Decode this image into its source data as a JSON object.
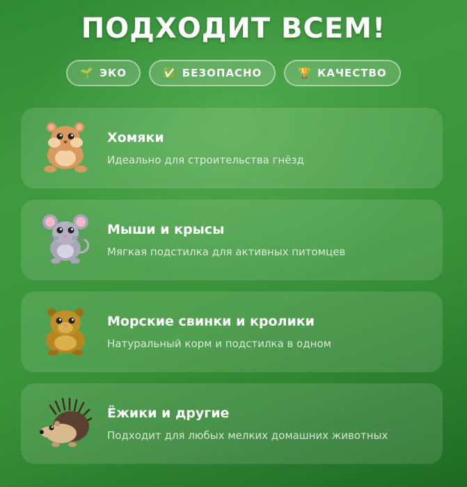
{
  "title": "ПОДХОДИТ ВСЕМ!",
  "badges": [
    {
      "icon": "🌱",
      "icon_name": "seedling-icon",
      "label": "ЭКО"
    },
    {
      "icon": "✅",
      "icon_name": "check-mark-icon",
      "label": "БЕЗОПАСНО"
    },
    {
      "icon": "🏆",
      "icon_name": "trophy-icon",
      "label": "КАЧЕСТВО"
    }
  ],
  "cards": [
    {
      "icon_name": "hamster-icon",
      "title": "Хомяки",
      "description": "Идеально для строительства гнёзд"
    },
    {
      "icon_name": "mouse-icon",
      "title": "Мыши и крысы",
      "description": "Мягкая подстилка для активных питомцев"
    },
    {
      "icon_name": "guinea-pig-icon",
      "title": "Морские свинки и кролики",
      "description": "Натуральный корм и подстилка в одном"
    },
    {
      "icon_name": "hedgehog-icon",
      "title": "Ёжики и другие",
      "description": "Подходит для любых мелких домашних животных"
    }
  ],
  "colors": {
    "background_top": "#2f8a35",
    "background_bottom": "#1f6a23",
    "text": "#ffffff"
  }
}
